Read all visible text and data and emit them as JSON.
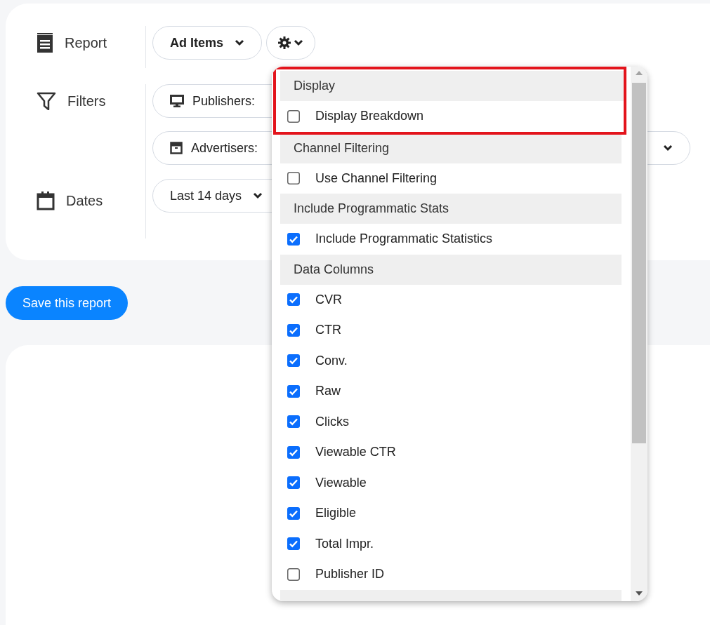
{
  "report": {
    "label": "Report",
    "button": "Ad Items"
  },
  "filters": {
    "label": "Filters",
    "buttons": [
      {
        "label": "Publishers:",
        "kind": "monitor"
      },
      {
        "label": "Advertisers:",
        "kind": "box"
      }
    ]
  },
  "dates": {
    "label": "Dates",
    "button": "Last 14 days"
  },
  "save_button": "Save this report",
  "settings_menu": {
    "sections": [
      {
        "heading": "Display",
        "highlighted": true,
        "items": [
          {
            "label": "Display Breakdown",
            "checked": false
          }
        ]
      },
      {
        "heading": "Channel Filtering",
        "highlighted": false,
        "items": [
          {
            "label": "Use Channel Filtering",
            "checked": false
          }
        ]
      },
      {
        "heading": "Include Programmatic Stats",
        "highlighted": false,
        "items": [
          {
            "label": "Include Programmatic Statistics",
            "checked": true
          }
        ]
      },
      {
        "heading": "Data Columns",
        "highlighted": false,
        "items": [
          {
            "label": "CVR",
            "checked": true
          },
          {
            "label": "CTR",
            "checked": true
          },
          {
            "label": "Conv.",
            "checked": true
          },
          {
            "label": "Raw",
            "checked": true
          },
          {
            "label": "Clicks",
            "checked": true
          },
          {
            "label": "Viewable CTR",
            "checked": true
          },
          {
            "label": "Viewable",
            "checked": true
          },
          {
            "label": "Eligible",
            "checked": true
          },
          {
            "label": "Total Impr.",
            "checked": true
          },
          {
            "label": "Publisher ID",
            "checked": false
          }
        ]
      }
    ]
  }
}
